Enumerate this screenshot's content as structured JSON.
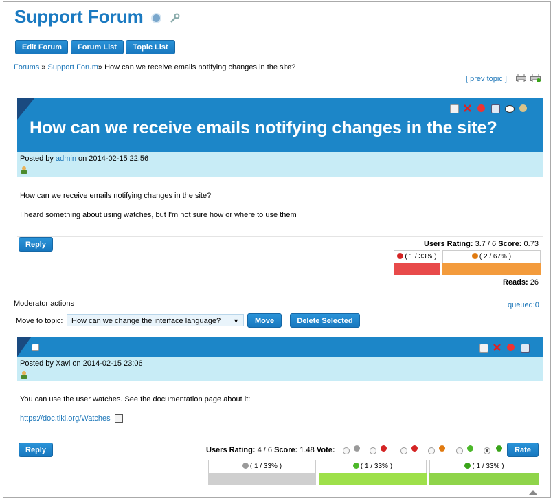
{
  "header": {
    "title": "Support Forum"
  },
  "nav": {
    "edit_forum": "Edit Forum",
    "forum_list": "Forum List",
    "topic_list": "Topic List"
  },
  "breadcrumb": {
    "forums": "Forums",
    "sep": "»",
    "forum": "Support Forum",
    "sep2": "»",
    "topic": "How can we receive emails notifying changes in the site?"
  },
  "topic_nav": {
    "prev": "[ prev topic ]"
  },
  "post1": {
    "title": "How can we receive emails notifying changes in the site?",
    "posted_by_label": "Posted by",
    "author": "admin",
    "posted_on": "on 2014-02-15 22:56",
    "body_line1": "How can we receive emails notifying changes in the site?",
    "body_line2": "I heard something about using watches, but I'm not sure how or where to use them",
    "reply_label": "Reply",
    "rating_label": "Users Rating:",
    "rating_value": "3.7 / 6",
    "score_label": "Score:",
    "score_value": "0.73",
    "ratings": [
      {
        "text": "( 1 / 33% )",
        "color": "#e84a4a",
        "face": "#d42424"
      },
      {
        "text": "( 2 / 67% )",
        "color": "#f39b3c",
        "face": "#e07a10"
      }
    ],
    "reads_label": "Reads:",
    "reads_value": "26"
  },
  "moderator": {
    "title": "Moderator actions",
    "queued": "queued:0",
    "move_label": "Move to topic:",
    "move_selected": "How can we change the interface language?",
    "move_button": "Move",
    "delete_button": "Delete Selected"
  },
  "post2": {
    "posted_by": "Posted by Xavi on 2014-02-15 23:06",
    "body_line1": "You can use the user watches. See the documentation page about it:",
    "link": "https://doc.tiki.org/Watches",
    "reply_label": "Reply",
    "rating_label": "Users Rating:",
    "rating_value": "4 / 6",
    "score_label": "Score:",
    "score_value": "1.48",
    "vote_label": "Vote:",
    "rate_button": "Rate",
    "vote_faces": [
      "#9a9a9a",
      "#d42424",
      "#d42424",
      "#e07a10",
      "#4cb82a",
      "#3aa41a"
    ],
    "ratings": [
      {
        "text": "( 1 / 33% )",
        "color": "#cfcfcf",
        "face": "#9a9a9a"
      },
      {
        "text": "( 1 / 33% )",
        "color": "#9ee04a",
        "face": "#4cb82a"
      },
      {
        "text": "( 1 / 33% )",
        "color": "#8fd44a",
        "face": "#3aa41a"
      }
    ]
  }
}
